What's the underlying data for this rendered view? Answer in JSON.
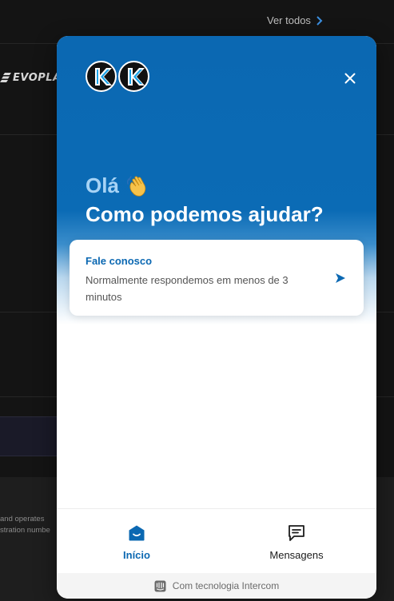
{
  "background": {
    "view_all_label": "Ver todos",
    "brand_label": "EVOPLA",
    "footer_line_1": "and operates",
    "footer_line_2": "stration numbe"
  },
  "messenger": {
    "greeting": "Olá",
    "greeting_emoji": "waving-hand",
    "subtitle": "Como podemos ajudar?",
    "contact": {
      "title": "Fale conosco",
      "description": "Normalmente respondemos em menos de 3 minutos"
    },
    "nav": {
      "home_label": "Início",
      "messages_label": "Mensagens"
    },
    "powered_by": "Com tecnologia Intercom"
  },
  "colors": {
    "primary": "#0b68b2",
    "greeting": "#a7d3f5",
    "page_background": "#141414"
  }
}
